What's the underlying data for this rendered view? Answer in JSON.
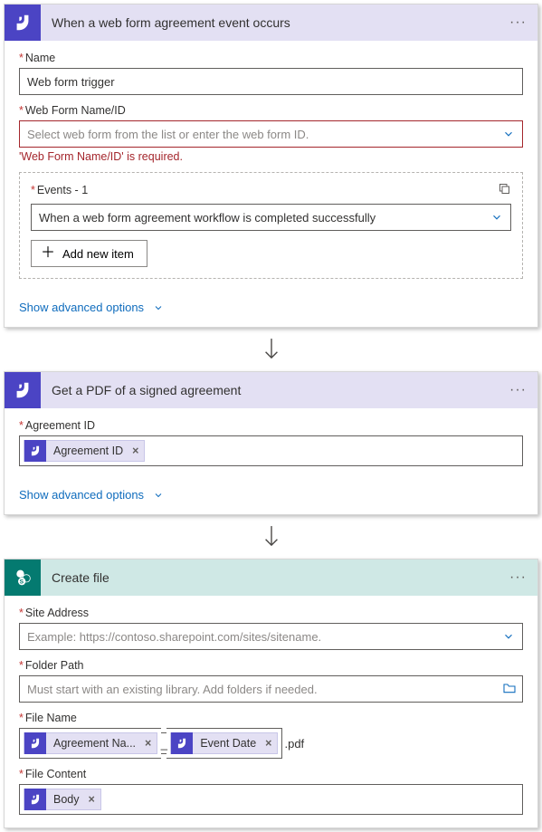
{
  "step1": {
    "title": "When a web form agreement event occurs",
    "name_label": "Name",
    "name_value": "Web form trigger",
    "form_label": "Web Form Name/ID",
    "form_placeholder": "Select web form from the list or enter the web form ID.",
    "form_error": "'Web Form Name/ID' is required.",
    "events_label": "Events - 1",
    "events_value": "When a web form agreement workflow is completed successfully",
    "add_item": "Add new item",
    "show_adv": "Show advanced options"
  },
  "step2": {
    "title": "Get a PDF of a signed agreement",
    "agreement_label": "Agreement ID",
    "token_agreement": "Agreement ID",
    "show_adv": "Show advanced options"
  },
  "step3": {
    "title": "Create file",
    "site_label": "Site Address",
    "site_placeholder": "Example: https://contoso.sharepoint.com/sites/sitename.",
    "folder_label": "Folder Path",
    "folder_placeholder": "Must start with an existing library. Add folders if needed.",
    "filename_label": "File Name",
    "token_agreement_name": "Agreement Na...",
    "token_event_date": "Event Date",
    "file_suffix": ".pdf",
    "filecontent_label": "File Content",
    "token_body": "Body"
  }
}
